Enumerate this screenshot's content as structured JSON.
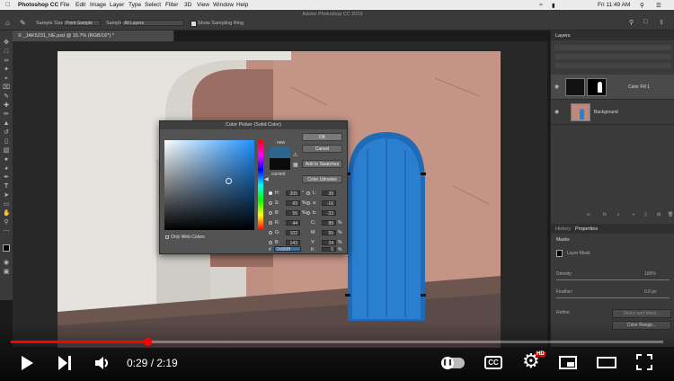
{
  "menubar": {
    "items": [
      "Photoshop CC",
      "File",
      "Edit",
      "Image",
      "Layer",
      "Type",
      "Select",
      "Filter",
      "3D",
      "View",
      "Window",
      "Help"
    ],
    "clock": "Fri 11:49 AM"
  },
  "window": {
    "title": "Adobe Photoshop CC 2019"
  },
  "options": {
    "sample_size_label": "Sample Size:",
    "sample_size_value": "Point Sample",
    "sample_label": "Sample:",
    "sample_value": "All Layers",
    "show_ring_label": "Show Sampling Ring"
  },
  "document": {
    "tab": "© _JAK5231_NE.psd @ 16.7% (RGB/16*) *"
  },
  "layers": {
    "tab": "Layers",
    "items": [
      {
        "name": "Color Fill 1"
      },
      {
        "name": "Background"
      }
    ]
  },
  "properties": {
    "tabs": [
      "History",
      "Properties"
    ],
    "section": "Masks",
    "layer_mask": "Layer Mask",
    "density_label": "Density:",
    "density_value": "100%",
    "feather_label": "Feather:",
    "feather_value": "0.0 px",
    "refine_label": "Refine:",
    "select_mask_button": "Select and Mask...",
    "color_range_button": "Color Range..."
  },
  "picker": {
    "title": "Color Picker (Solid Color)",
    "new_label": "new",
    "current_label": "current",
    "ok": "OK",
    "cancel": "Cancel",
    "add_swatches": "Add to Swatches",
    "color_libraries": "Color Libraries",
    "only_web": "Only Web Colors",
    "hex_label": "#",
    "hex": "2c668f",
    "new_color": "#2c668f",
    "current_color": "#0b0b0b",
    "values": {
      "H": {
        "v": "205",
        "u": "°"
      },
      "S": {
        "v": "69",
        "u": "%"
      },
      "B": {
        "v": "56",
        "u": "%"
      },
      "R": {
        "v": "44",
        "u": ""
      },
      "G": {
        "v": "102",
        "u": ""
      },
      "Bl": {
        "v": "143",
        "u": ""
      },
      "L": {
        "v": "39",
        "u": ""
      },
      "a": {
        "v": "-16",
        "u": ""
      },
      "b": {
        "v": "-33",
        "u": ""
      },
      "C": {
        "v": "89",
        "u": "%"
      },
      "M": {
        "v": "55",
        "u": "%"
      },
      "Y": {
        "v": "24",
        "u": "%"
      },
      "K": {
        "v": "5",
        "u": "%"
      }
    },
    "labels": {
      "H": "H:",
      "S": "S:",
      "B": "B:",
      "R": "R:",
      "G": "G:",
      "Bl": "B:",
      "L": "L:",
      "a": "a:",
      "b": "b:",
      "C": "C:",
      "M": "M:",
      "Y": "Y:",
      "K": "K:"
    }
  },
  "player": {
    "time": "0:29 / 2:19",
    "progress": 0.21,
    "hd_badge": "HD",
    "cc_label": "CC",
    "accent": "#ff0000"
  }
}
